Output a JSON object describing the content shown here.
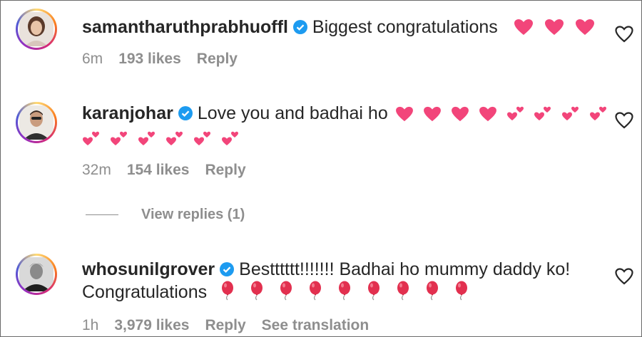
{
  "comments": [
    {
      "username": "samantharuthprabhuoffl",
      "text": "Biggest congratulations",
      "continuation": "",
      "time": "6m",
      "likes": "193 likes",
      "reply": "Reply",
      "extra": "",
      "emoji_line1": [
        "heart",
        "heart",
        "heart"
      ],
      "emoji_line2": []
    },
    {
      "username": "karanjohar",
      "text": "Love you and badhai ho",
      "continuation": "",
      "time": "32m",
      "likes": "154 likes",
      "reply": "Reply",
      "extra": "",
      "emoji_line1": [
        "heart",
        "heart",
        "heart",
        "heart",
        "two-hearts",
        "two-hearts",
        "two-hearts",
        "two-hearts"
      ],
      "emoji_line2": [
        "two-hearts",
        "two-hearts",
        "two-hearts",
        "two-hearts",
        "two-hearts",
        "two-hearts"
      ]
    },
    {
      "username": "whosunilgrover",
      "text": "Bestttttt!!!!!!! Badhai ho mummy daddy ko!",
      "continuation": "Congratulations",
      "time": "1h",
      "likes": "3,979 likes",
      "reply": "Reply",
      "extra": "See translation",
      "emoji_line1": [],
      "emoji_line2": [
        "balloon",
        "balloon",
        "balloon",
        "balloon",
        "balloon",
        "balloon",
        "balloon",
        "balloon",
        "balloon"
      ]
    }
  ],
  "view_replies": "View replies (1)",
  "colors": {
    "verified": "#1d9bf0",
    "heart": "#f2457a",
    "meta": "#8e8e8e",
    "text": "#262626"
  }
}
